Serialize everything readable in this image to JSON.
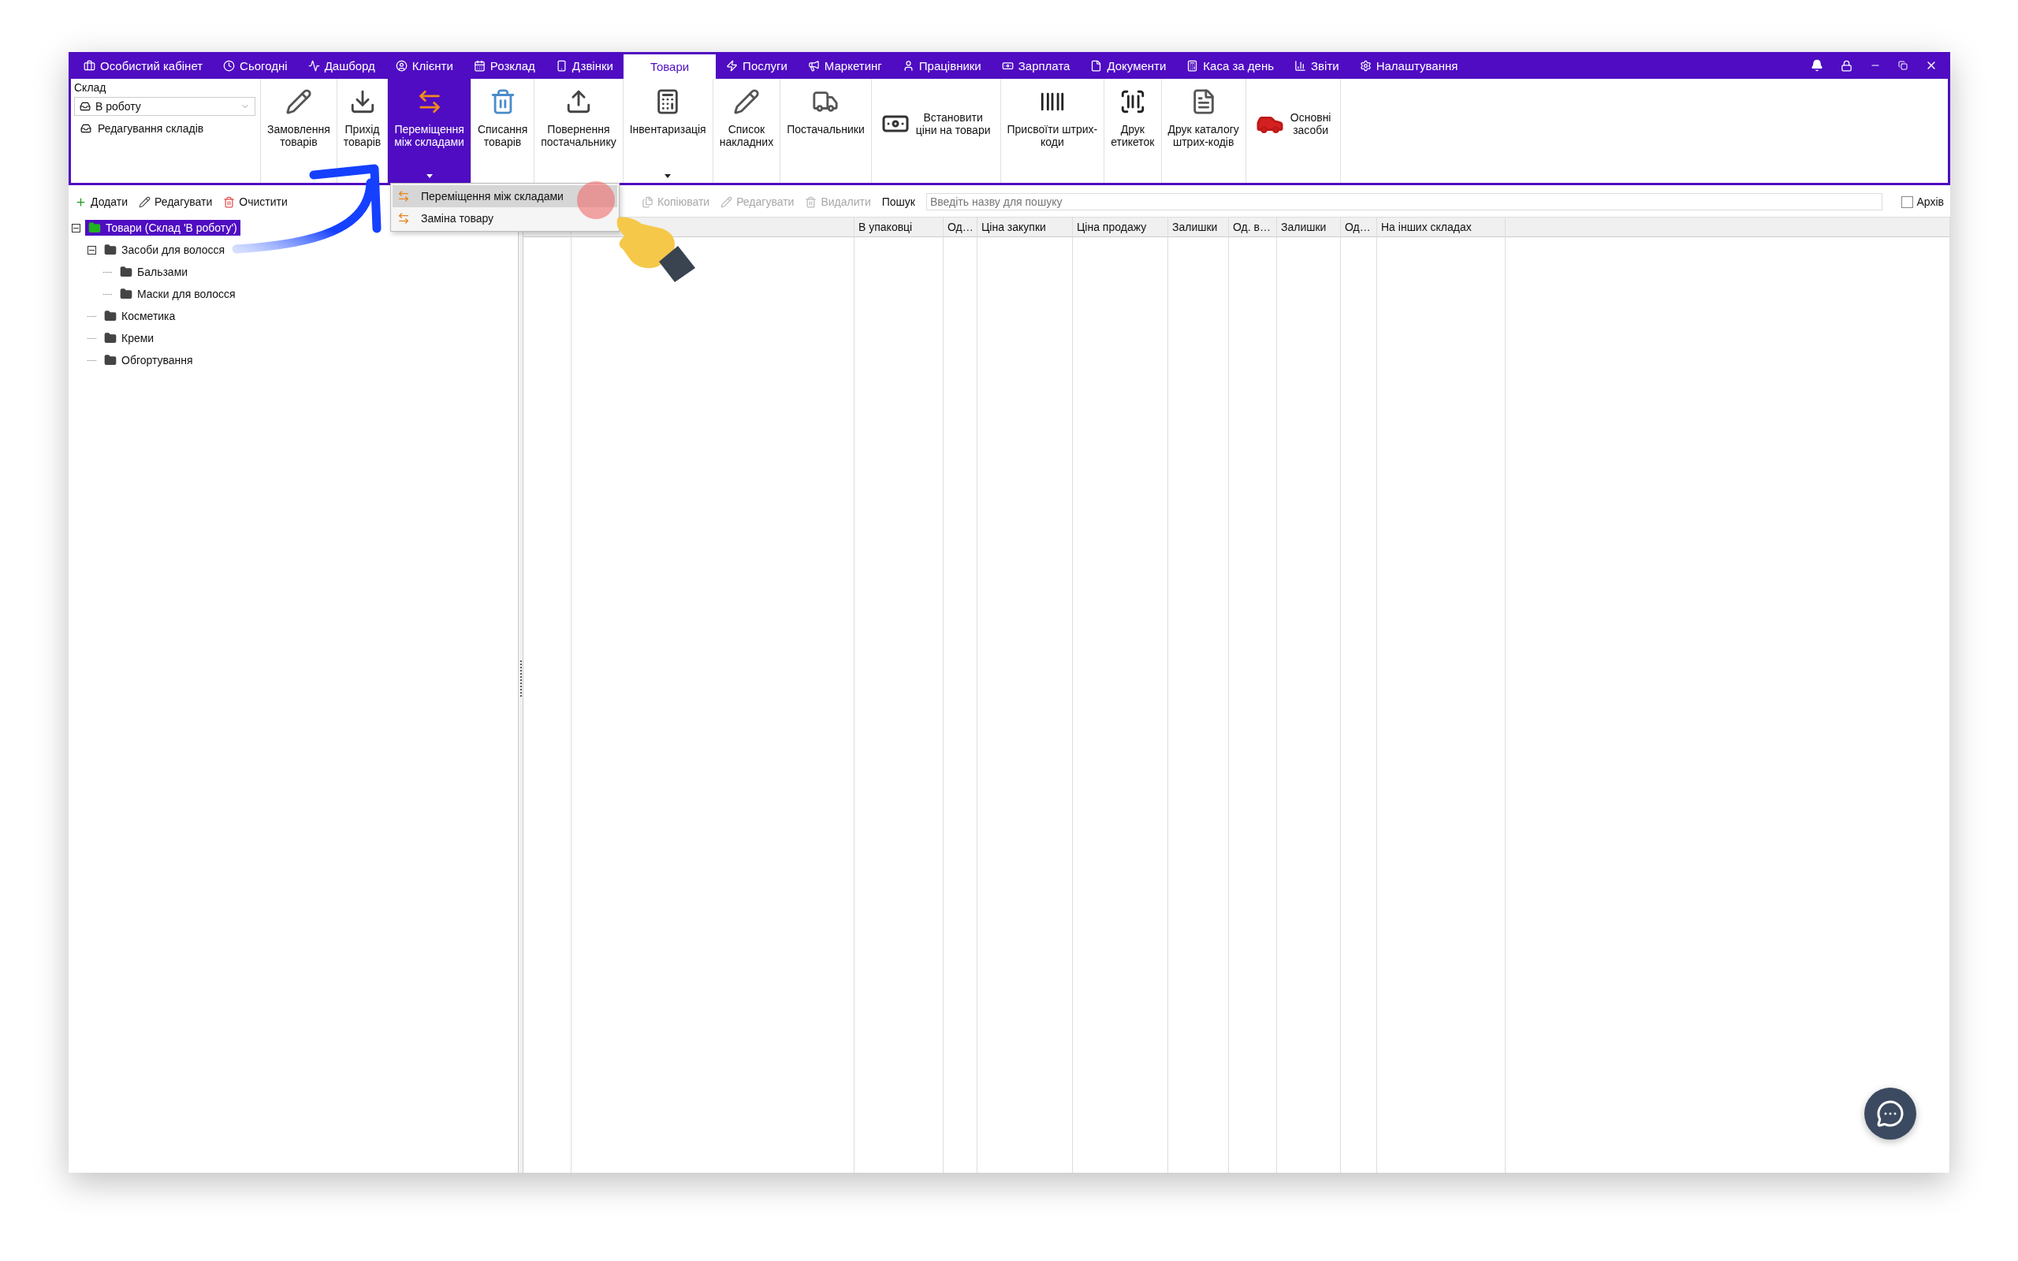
{
  "menu_bar": {
    "items": [
      {
        "label": "Особистий кабінет",
        "selected": false
      },
      {
        "label": "Сьогодні",
        "selected": false
      },
      {
        "label": "Дашборд",
        "selected": false
      },
      {
        "label": "Клієнти",
        "selected": false
      },
      {
        "label": "Розклад",
        "selected": false
      },
      {
        "label": "Дзвінки",
        "selected": false
      },
      {
        "label": "Товари",
        "selected": true
      },
      {
        "label": "Послуги",
        "selected": false
      },
      {
        "label": "Маркетинг",
        "selected": false
      },
      {
        "label": "Працівники",
        "selected": false
      },
      {
        "label": "Зарплата",
        "selected": false
      },
      {
        "label": "Документи",
        "selected": false
      },
      {
        "label": "Каса за день",
        "selected": false
      },
      {
        "label": "Звіти",
        "selected": false
      },
      {
        "label": "Налаштування",
        "selected": false
      }
    ]
  },
  "warehouse": {
    "label": "Склад",
    "value": "В роботу",
    "edit_link": "Редагування складів"
  },
  "toolbar": {
    "buttons": [
      {
        "label": "Замовлення\nтоварів",
        "kind": "vertical",
        "selected": false,
        "dropdown": false
      },
      {
        "label": "Прихід\nтоварів",
        "kind": "vertical",
        "selected": false,
        "dropdown": false
      },
      {
        "label": "Переміщення\nміж складами",
        "kind": "vertical",
        "selected": true,
        "dropdown": true
      },
      {
        "label": "Списання\nтоварів",
        "kind": "vertical",
        "selected": false,
        "dropdown": false
      },
      {
        "label": "Повернення\nпостачальнику",
        "kind": "vertical",
        "selected": false,
        "dropdown": false
      },
      {
        "label": "Інвентаризація",
        "kind": "vertical",
        "selected": false,
        "dropdown": true
      },
      {
        "label": "Список\nнакладних",
        "kind": "vertical",
        "selected": false,
        "dropdown": false
      },
      {
        "label": "Постачальники",
        "kind": "vertical",
        "selected": false,
        "dropdown": false
      },
      {
        "label": "Встановити\nціни на товари",
        "kind": "horizontal",
        "selected": false,
        "dropdown": false
      },
      {
        "label": "Присвоїти штрих-\nкоди",
        "kind": "vertical",
        "selected": false,
        "dropdown": false
      },
      {
        "label": "Друк\nетикеток",
        "kind": "vertical",
        "selected": false,
        "dropdown": false
      },
      {
        "label": "Друк каталогу\nштрих-кодів",
        "kind": "vertical",
        "selected": false,
        "dropdown": false
      },
      {
        "label": "Основні\nзасоби",
        "kind": "horizontal",
        "selected": false,
        "dropdown": false
      }
    ]
  },
  "dropdown_menu": {
    "items": [
      {
        "label": "Переміщення між складами",
        "selected": true
      },
      {
        "label": "Заміна товару",
        "selected": false
      }
    ]
  },
  "tree_toolbar": {
    "buttons": [
      {
        "label": "Додати",
        "disabled": false
      },
      {
        "label": "Редагувати",
        "disabled": false
      },
      {
        "label": "Очистити",
        "disabled": false
      }
    ]
  },
  "tree": {
    "items": [
      {
        "label": "Товари (Склад 'В роботу')",
        "selected": true,
        "expanded": true,
        "children": [
          {
            "label": "Засоби для волосся",
            "selected": false,
            "expanded": true,
            "children": [
              {
                "label": "Бальзами",
                "selected": false
              },
              {
                "label": "Маски для волосся",
                "selected": false
              }
            ]
          },
          {
            "label": "Косметика",
            "selected": false
          },
          {
            "label": "Креми",
            "selected": false
          },
          {
            "label": "Обгортування",
            "selected": false
          }
        ]
      }
    ]
  },
  "goods_toolbar": {
    "buttons": [
      {
        "label": "Копіювати",
        "disabled": true
      },
      {
        "label": "Редагувати",
        "disabled": true
      },
      {
        "label": "Видалити",
        "disabled": true
      }
    ],
    "search_label": "Пошук",
    "search_placeholder": "Введіть назву для пошуку",
    "archive": {
      "label": "Архів",
      "checked": false
    }
  },
  "table": {
    "columns": [
      "В упаковці",
      "Од…",
      "Ціна закупки",
      "Ціна продажу",
      "Залишки",
      "Од. в…",
      "Залишки",
      "Од…",
      "На інших складах"
    ]
  }
}
